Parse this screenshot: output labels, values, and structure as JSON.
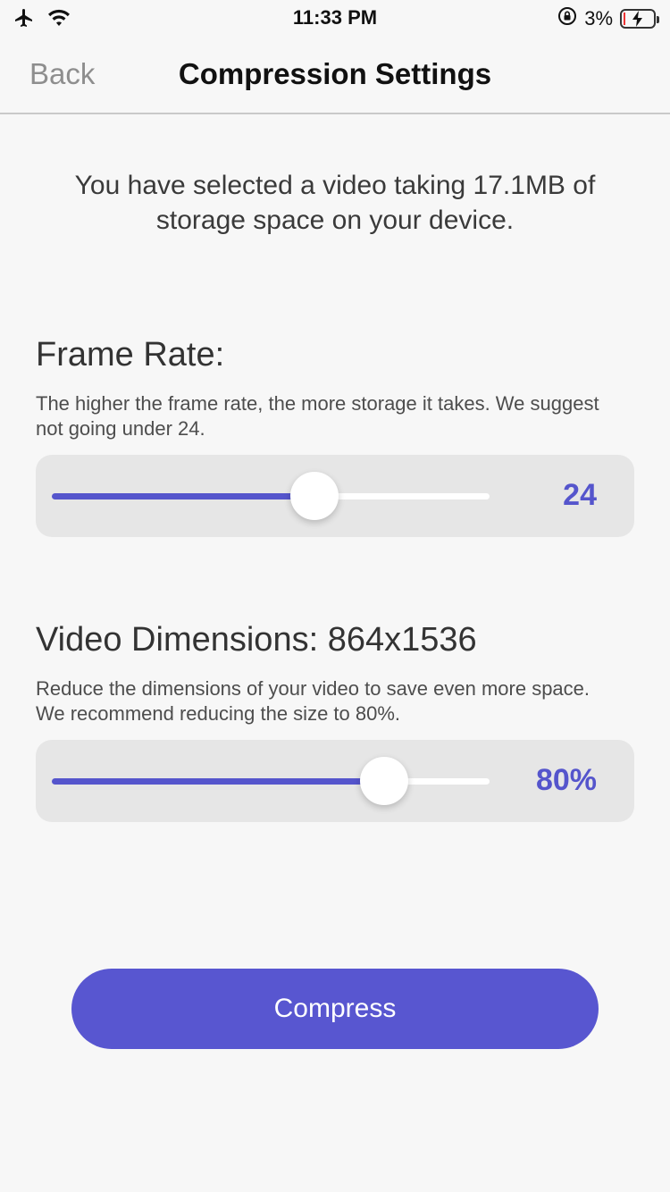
{
  "status_bar": {
    "time": "11:33 PM",
    "battery_percent": "3%",
    "icons": [
      "airplane-icon",
      "wifi-icon",
      "orientation-lock-icon",
      "battery-charging-icon"
    ]
  },
  "nav": {
    "back_label": "Back",
    "title": "Compression Settings"
  },
  "intro": "You have selected a video taking 17.1MB of storage space on your device.",
  "frame_rate": {
    "title": "Frame Rate:",
    "description": "The higher the frame rate, the more storage it takes. We suggest not going under 24.",
    "value_label": "24",
    "slider_fraction": 0.6
  },
  "dimensions": {
    "title": "Video Dimensions: 864x1536",
    "description": "Reduce the dimensions of your video to save even more space. We recommend reducing the size to 80%.",
    "value_label": "80%",
    "slider_fraction": 0.76
  },
  "compress_label": "Compress",
  "colors": {
    "accent": "#5856d0",
    "background": "#f7f7f7",
    "card": "#e6e6e6"
  }
}
